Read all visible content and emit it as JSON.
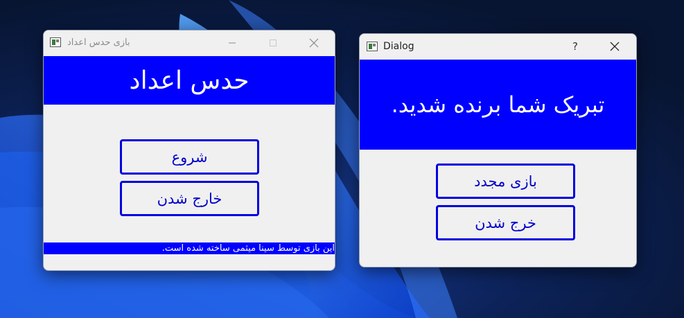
{
  "colors": {
    "accent": "#0000ff",
    "window_bg": "#f0f0f0",
    "button_border": "#0000e0"
  },
  "game_window": {
    "title": "بازی حدس اعداد",
    "heading": "حدس اعداد",
    "start_button": "شروع",
    "exit_button": "خارج شدن",
    "footer": "این بازی توسط سینا میثمی ساخته شده است."
  },
  "dialog_window": {
    "title": "Dialog",
    "help_glyph": "?",
    "message": "تبریک شما برنده شدید.",
    "replay_button": "بازی مجدد",
    "exit_button": "خرج شدن"
  },
  "titlebar_icons": {
    "minimize": "minimize-icon",
    "maximize": "maximize-icon",
    "close": "close-icon",
    "help": "help-icon"
  }
}
